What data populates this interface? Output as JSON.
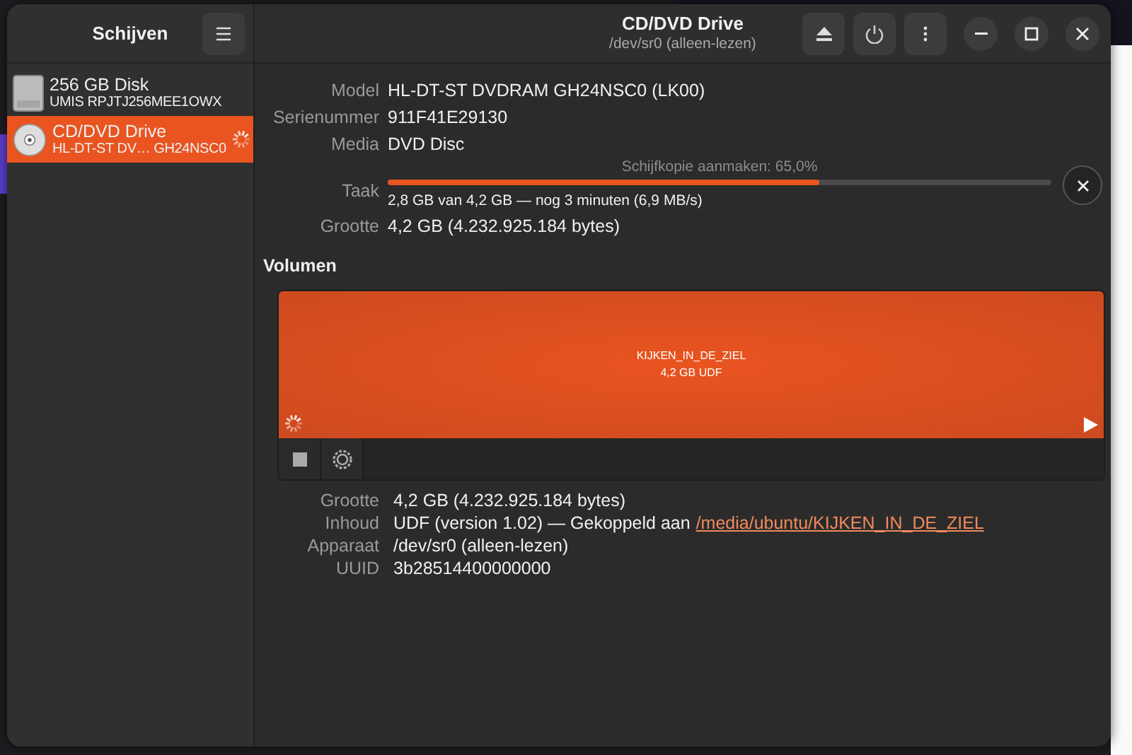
{
  "sidebar": {
    "title": "Schijven",
    "drives": [
      {
        "name": "256 GB Disk",
        "model": "UMIS RPJTJ256MEE1OWX",
        "kind": "ssd",
        "selected": false,
        "busy": false
      },
      {
        "name": "CD/DVD Drive",
        "model": "HL-DT-ST DV… GH24NSC0",
        "kind": "optical",
        "selected": true,
        "busy": true
      }
    ]
  },
  "header": {
    "title": "CD/DVD Drive",
    "subtitle": "/dev/sr0 (alleen-lezen)"
  },
  "drive_info": [
    {
      "kind": "text",
      "label": "Model",
      "value": "HL-DT-ST DVDRAM GH24NSC0 (LK00)"
    },
    {
      "kind": "text",
      "label": "Serienummer",
      "value": "911F41E29130"
    },
    {
      "kind": "text",
      "label": "Media",
      "value": "DVD Disc"
    },
    {
      "kind": "progress",
      "label": "Taak",
      "caption": "Schijfkopie aanmaken: 65,0%",
      "level": 0.65,
      "detail": "2,8 GB van 4,2 GB — nog 3 minuten (6,9 MB/s)"
    },
    {
      "kind": "text",
      "label": "Grootte",
      "value": "4,2 GB (4.232.925.184 bytes)"
    }
  ],
  "volumes_heading": "Volumen",
  "volume": {
    "name": "KIJKEN_IN_DE_ZIEL",
    "summary": "4,2 GB UDF",
    "selected": true,
    "busy": true
  },
  "volume_info": [
    {
      "label": "Grootte",
      "value": "4,2 GB (4.232.925.184 bytes)"
    },
    {
      "label": "Inhoud",
      "value": "UDF (version 1.02) — Gekoppeld aan",
      "link": "/media/ubuntu/KIJKEN_IN_DE_ZIEL"
    },
    {
      "label": "Apparaat",
      "value": "/dev/sr0 (alleen-lezen)"
    },
    {
      "label": "UUID",
      "value": "3b28514400000000"
    }
  ]
}
